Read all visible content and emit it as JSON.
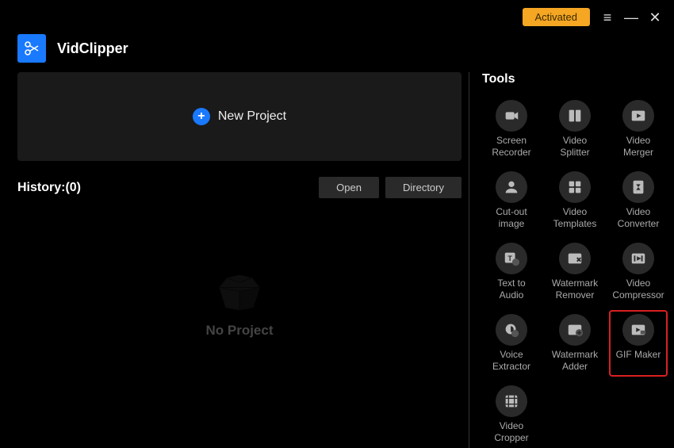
{
  "titlebar": {
    "activated_label": "Activated"
  },
  "app": {
    "name": "VidClipper"
  },
  "main": {
    "new_project_label": "New Project",
    "history_label": "History:(0)",
    "open_label": "Open",
    "directory_label": "Directory",
    "no_project_label": "No Project"
  },
  "tools_title": "Tools",
  "tools": [
    {
      "label": "Screen\nRecorder",
      "icon": "camera"
    },
    {
      "label": "Video\nSplitter",
      "icon": "splitter"
    },
    {
      "label": "Video\nMerger",
      "icon": "play"
    },
    {
      "label": "Cut-out\nimage",
      "icon": "person"
    },
    {
      "label": "Video\nTemplates",
      "icon": "templates"
    },
    {
      "label": "Video\nConverter",
      "icon": "converter"
    },
    {
      "label": "Text to\nAudio",
      "icon": "text-audio"
    },
    {
      "label": "Watermark\nRemover",
      "icon": "wm-remove"
    },
    {
      "label": "Video\nCompressor",
      "icon": "compress"
    },
    {
      "label": "Voice\nExtractor",
      "icon": "voice"
    },
    {
      "label": "Watermark\nAdder",
      "icon": "wm-add"
    },
    {
      "label": "GIF Maker",
      "icon": "gif",
      "highlight": true
    },
    {
      "label": "Video\nCropper",
      "icon": "cropper"
    }
  ]
}
